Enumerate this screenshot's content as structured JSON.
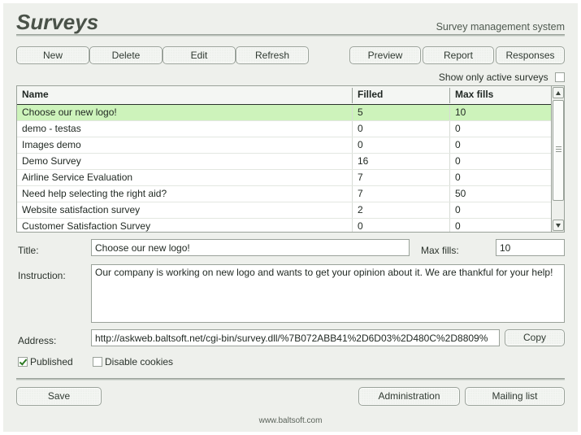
{
  "header": {
    "title": "Surveys",
    "subtitle": "Survey management system"
  },
  "toolbar": {
    "left_buttons": [
      {
        "label": "New",
        "name": "new-button"
      },
      {
        "label": "Delete",
        "name": "delete-button"
      },
      {
        "label": "Edit",
        "name": "edit-button"
      },
      {
        "label": "Refresh",
        "name": "refresh-button"
      }
    ],
    "right_buttons": [
      {
        "label": "Preview",
        "name": "preview-button"
      },
      {
        "label": "Report",
        "name": "report-button"
      },
      {
        "label": "Responses",
        "name": "responses-button"
      }
    ]
  },
  "filter": {
    "show_active_label": "Show only active surveys",
    "show_active_checked": false
  },
  "grid": {
    "columns": [
      "Name",
      "Filled",
      "Max fills"
    ],
    "rows": [
      {
        "name": "Choose our new logo!",
        "filled": "5",
        "max_fills": "10",
        "selected": true
      },
      {
        "name": "demo - testas",
        "filled": "0",
        "max_fills": "0",
        "selected": false
      },
      {
        "name": "Images demo",
        "filled": "0",
        "max_fills": "0",
        "selected": false
      },
      {
        "name": "Demo Survey",
        "filled": "16",
        "max_fills": "0",
        "selected": false
      },
      {
        "name": "Airline Service Evaluation",
        "filled": "7",
        "max_fills": "0",
        "selected": false
      },
      {
        "name": "Need help selecting the right aid?",
        "filled": "7",
        "max_fills": "50",
        "selected": false
      },
      {
        "name": "Website satisfaction survey",
        "filled": "2",
        "max_fills": "0",
        "selected": false
      },
      {
        "name": "Customer Satisfaction Survey",
        "filled": "0",
        "max_fills": "0",
        "selected": false
      }
    ]
  },
  "form": {
    "title_label": "Title:",
    "title_value": "Choose our new logo!",
    "max_fills_label": "Max fills:",
    "max_fills_value": "10",
    "instruction_label": "Instruction:",
    "instruction_value": "Our company is working on new logo and wants to get your opinion about it. We are thankful for your help!",
    "address_label": "Address:",
    "address_value": "http://askweb.baltsoft.net/cgi-bin/survey.dll/%7B072ABB41%2D6D03%2D480C%2D8809%",
    "copy_label": "Copy",
    "published_label": "Published",
    "published_checked": true,
    "disable_cookies_label": "Disable cookies",
    "disable_cookies_checked": false
  },
  "actions": {
    "save_label": "Save",
    "administration_label": "Administration",
    "mailing_list_label": "Mailing list"
  },
  "footer": {
    "link": "www.baltsoft.com"
  },
  "colors": {
    "panel": "#eef0ec",
    "selected_row": "#cdf3bb",
    "border": "#9aa29a",
    "text": "#202824",
    "check": "#2d7a22"
  }
}
